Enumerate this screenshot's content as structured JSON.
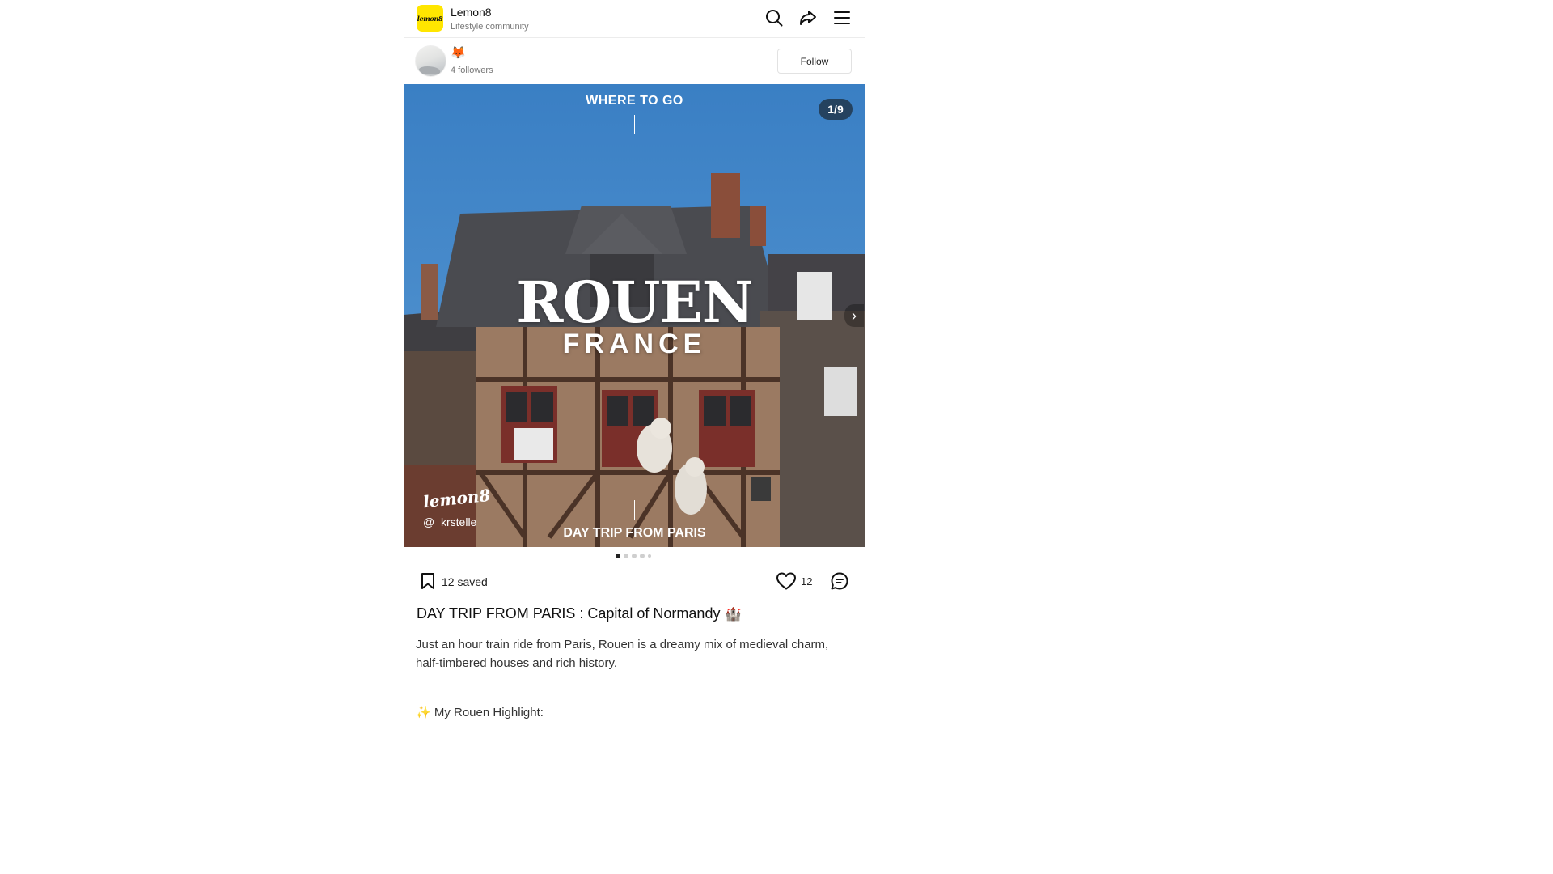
{
  "header": {
    "logo_text": "lemon8",
    "app_name": "Lemon8",
    "subtitle": "Lifestyle community",
    "icons": [
      "search-icon",
      "share-icon",
      "menu-icon"
    ]
  },
  "author": {
    "emoji": "🦊",
    "followers": "4 followers",
    "follow_label": "Follow"
  },
  "slide": {
    "top_caption": "WHERE TO GO",
    "title": "ROUEN",
    "subtitle": "FRANCE",
    "bottom_caption": "DAY TRIP FROM PARIS",
    "counter": "1/9",
    "watermark_logo": "lemon8",
    "watermark_handle": "@_krstelle",
    "next_glyph": "›"
  },
  "actions": {
    "saved": "12 saved",
    "likes": "12"
  },
  "post": {
    "title": "DAY TRIP FROM PARIS : Capital of Normandy",
    "title_emoji": "🏰",
    "body": "Just an hour train ride from Paris, Rouen is a dreamy mix of medieval charm, half-timbered houses and rich history.",
    "highlight": "✨ My Rouen Highlight:"
  },
  "colors": {
    "brand_yellow": "#ffe600",
    "sky": "#3f85c8"
  }
}
